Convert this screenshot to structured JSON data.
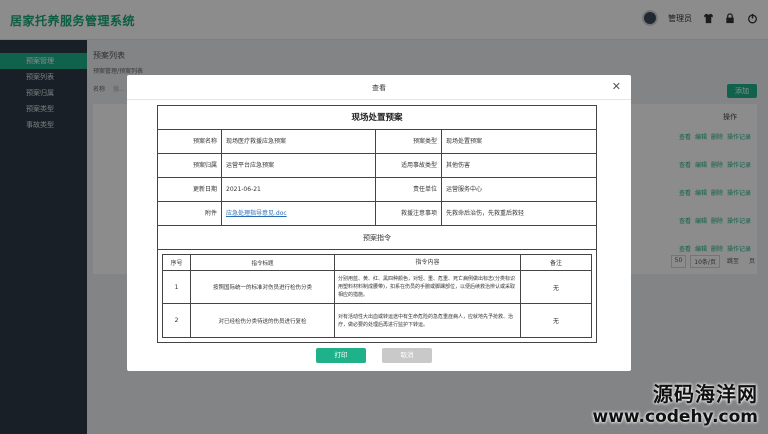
{
  "app": {
    "title": "居家托养服务管理系统",
    "username": "管理员"
  },
  "sidebar": {
    "items": [
      {
        "label": "预案管理"
      },
      {
        "label": "预案列表"
      },
      {
        "label": "预案归属"
      },
      {
        "label": "预案类型"
      },
      {
        "label": "事故类型"
      }
    ]
  },
  "page": {
    "heading": "预案列表",
    "breadcrumb": "预案管理/预案列表",
    "filter_label": "名称",
    "filter_placeholder": "搜...",
    "add_label": "添加",
    "op_header": "操作",
    "row_ops": [
      "查看",
      "编辑",
      "删除",
      "操作记录"
    ],
    "pager": [
      "50",
      "10条/页",
      "跳至",
      "页"
    ]
  },
  "modal": {
    "title": "查看",
    "sheet_title": "现场处置预案",
    "rows": [
      {
        "l1": "预案名称",
        "v1": "现场医疗救援应急预案",
        "l2": "预案类型",
        "v2": "现场处置预案"
      },
      {
        "l1": "预案归属",
        "v1": "运营平台应急预案",
        "l2": "适用事故类型",
        "v2": "其他伤害"
      },
      {
        "l1": "更新日期",
        "v1": "2021-06-21",
        "l2": "责任单位",
        "v2": "运营服务中心"
      },
      {
        "l1": "附件",
        "v1": "应急处理指导意见.doc",
        "l2": "救援注意事项",
        "v2": "先救命后治伤，先救重后救轻"
      }
    ],
    "section_title": "预案指令",
    "cmd_headers": {
      "no": "序号",
      "title": "指令标题",
      "content": "指令内容",
      "note": "备注"
    },
    "commands": [
      {
        "no": "1",
        "title": "按照国际统一的标准对伤员进行检伤分类",
        "content": "分别用蓝、黄、红、黑四种颜色，对轻、重、危重、死亡病例做出标志(分类标识用塑料材料制成腰带)，扣系在伤员的手腕或脚踝部位，以便后续救治辨认或采取相应的措施。",
        "note": "无"
      },
      {
        "no": "2",
        "title": "对已经检伤分类待送的伤员进行复检",
        "content": "对有活动性大出血或转运途中有生命危险的急危重症病人，应就地先予抢救、治疗，做必要的处理后再进行监护下转运。",
        "note": "无"
      }
    ],
    "print_label": "打印",
    "cancel_label": "取消"
  },
  "watermark": {
    "line1": "源码海洋网",
    "line2": "www.codehy.com"
  },
  "colors": {
    "accent": "#1fb28a",
    "sidebar": "#2d3a45",
    "title": "#19a97b"
  }
}
